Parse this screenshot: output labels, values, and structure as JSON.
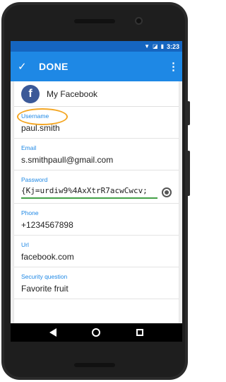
{
  "status_bar": {
    "time": "3:23"
  },
  "app_bar": {
    "done_label": "DONE"
  },
  "entry": {
    "title": "My Facebook",
    "icon_letter": "f",
    "icon_color": "#3b5998"
  },
  "fields": {
    "username": {
      "label": "Username",
      "value": "paul.smith"
    },
    "email": {
      "label": "Email",
      "value": "s.smithpaull@gmail.com"
    },
    "password": {
      "label": "Password",
      "value": "{Kj=urdiw9%4AxXtrR7acwCwcv;"
    },
    "phone": {
      "label": "Phone",
      "value": "+1234567898"
    },
    "url": {
      "label": "Url",
      "value": "facebook.com"
    },
    "security_question": {
      "label": "Security question",
      "value": "Favorite fruit"
    }
  },
  "colors": {
    "app_bar": "#1e88e5",
    "status_bar": "#1565c0",
    "label": "#1e88e5",
    "highlight": "#f4a623",
    "password_underline": "#43a047"
  }
}
